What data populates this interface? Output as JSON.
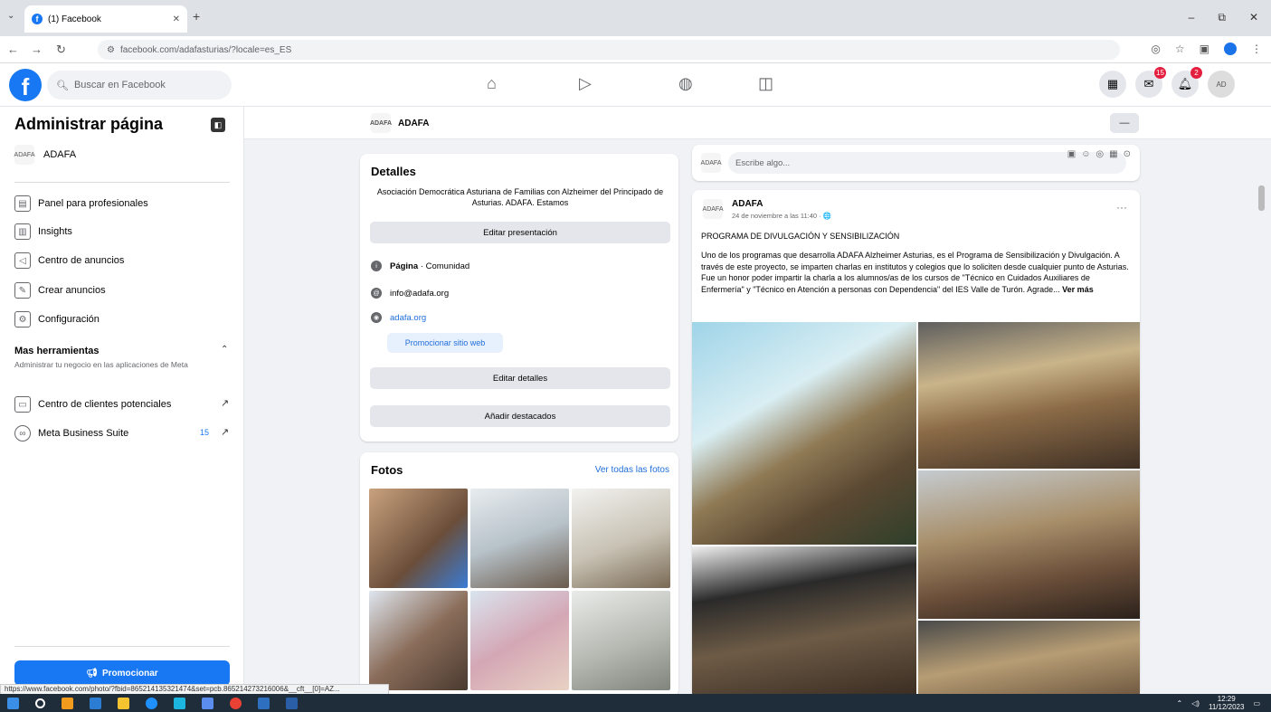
{
  "browser": {
    "tab_title": "(1) Facebook",
    "tab_close": "✕",
    "new_tab": "+",
    "url": "facebook.com/adafasturias/?locale=es_ES",
    "window_controls": [
      "–",
      "⧉",
      "✕"
    ]
  },
  "fb": {
    "search_placeholder": "Buscar en Facebook",
    "messenger_badge": "15",
    "notifications_badge": "2"
  },
  "sidebar": {
    "title": "Administrar página",
    "page_name": "ADAFA",
    "items": [
      {
        "label": "Panel para profesionales",
        "icon": "dashboard-icon"
      },
      {
        "label": "Insights",
        "icon": "insights-icon"
      },
      {
        "label": "Centro de anuncios",
        "icon": "megaphone-icon"
      },
      {
        "label": "Crear anuncios",
        "icon": "edit-icon"
      },
      {
        "label": "Configuración",
        "icon": "gear-icon"
      }
    ],
    "more_tools": "Mas herramientas",
    "more_tools_sub": "Administrar tu negocio en las aplicaciones de Meta",
    "tools": [
      {
        "label": "Centro de clientes potenciales",
        "icon": "leads-icon"
      },
      {
        "label": "Meta Business Suite",
        "icon": "meta-icon",
        "count": "15"
      }
    ],
    "promote_label": "Promocionar"
  },
  "pagebar": {
    "name": "ADAFA",
    "more": "—"
  },
  "details": {
    "title": "Detalles",
    "description": "Asociación Democrática Asturiana de Familias con Alzheimer del Principado de Asturias. ADAFA. Estamos",
    "edit_intro": "Editar presentación",
    "category_label": "Página",
    "category_value": " · Comunidad",
    "email": "info@adafa.org",
    "website": "adafa.org",
    "promote_site": "Promocionar sitio web",
    "edit_details": "Editar detalles",
    "add_featured": "Añadir destacados"
  },
  "photos": {
    "title": "Fotos",
    "see_all": "Ver todas las fotos"
  },
  "composer": {
    "placeholder": "Escribe algo..."
  },
  "post": {
    "author": "ADAFA",
    "date": "24 de noviembre a las 11:40 · 🌐",
    "more": "···",
    "headline": "PROGRAMA DE DIVULGACIÓN Y SENSIBILIZACIÓN",
    "body": "Uno de los programas que desarrolla ADAFA  Alzheimer Asturias, es el Programa de Sensibilización y Divulgación. A través de este proyecto, se imparten charlas en institutos y colegios que lo soliciten desde cualquier punto de Asturias. Fue un honor poder impartir la charla a los alumnos/as de los cursos de \"Técnico en Cuidados Auxiliares de Enfermería\" y \"Técnico en Atención a personas con Dependencia\" del IES Valle de Turón. Agrade...",
    "see_more": "Ver más"
  },
  "status_url": "https://www.facebook.com/photo/?fbid=865214135321474&set=pcb.865214273216006&__cft__[0]=AZ...",
  "taskbar": {
    "time": "12:29",
    "date": "11/12/2023"
  },
  "colors": {
    "brand": "#1877f2",
    "link": "#216fdb",
    "badge": "#e41e3f"
  }
}
